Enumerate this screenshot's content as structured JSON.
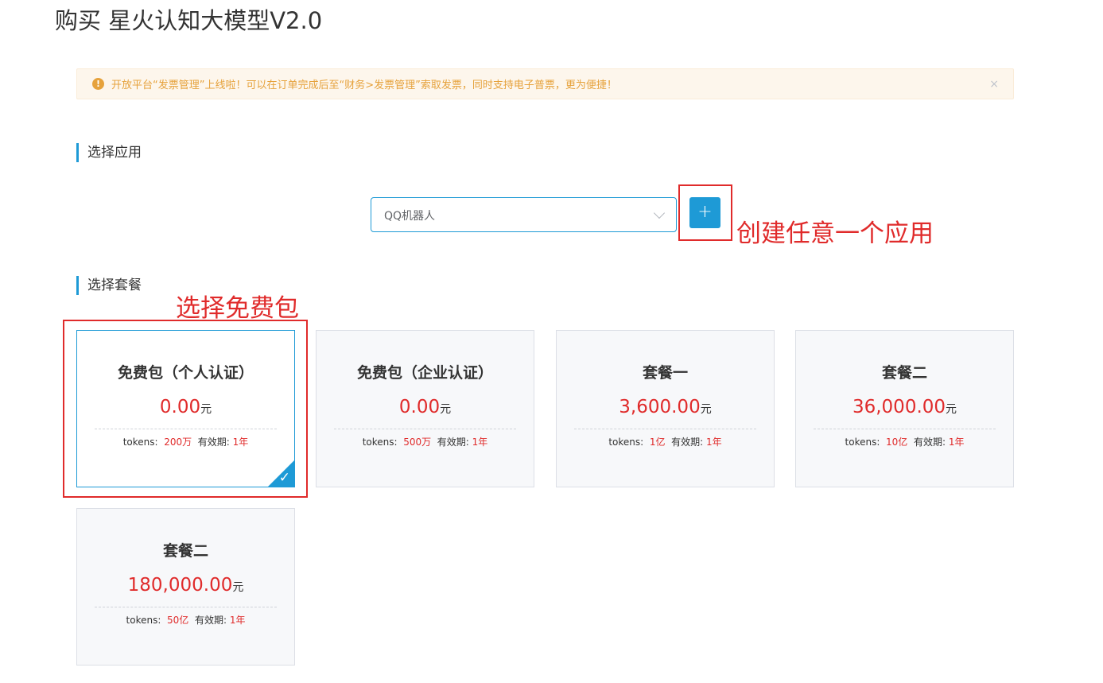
{
  "page": {
    "title": "购买 星火认知大模型V2.0"
  },
  "notice": {
    "icon": "warning-icon",
    "text": "开放平台“发票管理”上线啦！可以在订单完成后至“财务>发票管理”索取发票，同时支持电子普票，更为便捷！",
    "close": "×"
  },
  "sections": {
    "app": "选择应用",
    "package": "选择套餐"
  },
  "app_select": {
    "value": "QQ机器人",
    "add_label": "+"
  },
  "annotations": {
    "create_app": "创建任意一个应用",
    "choose_free": "选择免费包"
  },
  "packages": [
    {
      "name": "免费包（个人认证）",
      "price": "0.00",
      "unit": "元",
      "tokens_label": "tokens:",
      "tokens": "200万",
      "validity_label": "有效期:",
      "validity": "1年"
    },
    {
      "name": "免费包（企业认证）",
      "price": "0.00",
      "unit": "元",
      "tokens_label": "tokens:",
      "tokens": "500万",
      "validity_label": "有效期:",
      "validity": "1年"
    },
    {
      "name": "套餐一",
      "price": "3,600.00",
      "unit": "元",
      "tokens_label": "tokens:",
      "tokens": "1亿",
      "validity_label": "有效期:",
      "validity": "1年"
    },
    {
      "name": "套餐二",
      "price": "36,000.00",
      "unit": "元",
      "tokens_label": "tokens:",
      "tokens": "10亿",
      "validity_label": "有效期:",
      "validity": "1年"
    },
    {
      "name": "套餐二",
      "price": "180,000.00",
      "unit": "元",
      "tokens_label": "tokens:",
      "tokens": "50亿",
      "validity_label": "有效期:",
      "validity": "1年"
    }
  ],
  "selected_mark": "✓",
  "colors": {
    "accent": "#1e9ad6",
    "price_red": "#e02b2b",
    "warning": "#e6a23c",
    "annotation_red": "#e02b2b"
  }
}
